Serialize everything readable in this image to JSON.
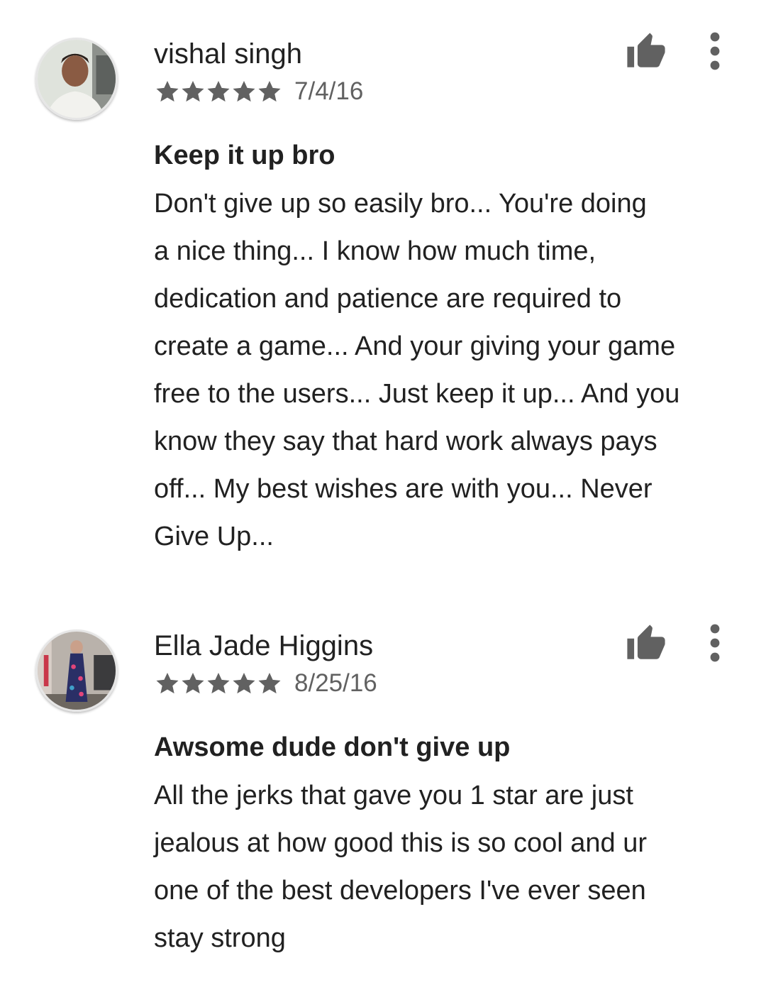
{
  "reviews": [
    {
      "author": "vishal singh",
      "rating": 5,
      "date": "7/4/16",
      "title": "Keep it up bro",
      "body_lines": [
        "Don't give up so easily bro... You're doing",
        "a nice thing... I know how much time,",
        "dedication and patience are required to",
        "create a game... And your giving your game",
        "free to the users... Just keep it up... And you",
        "know they say that hard work always pays",
        "off... My best wishes are with you... Never",
        "Give Up..."
      ]
    },
    {
      "author": "Ella Jade Higgins",
      "rating": 5,
      "date": "8/25/16",
      "title": "Awsome dude don't give up",
      "body_lines": [
        "All the jerks that gave you 1 star are just",
        "jealous at how good this is so cool and ur",
        "one of the best developers I've ever seen",
        "stay strong"
      ]
    }
  ],
  "icons": {
    "thumb": "thumbs-up-icon",
    "more": "more-vert-icon",
    "star": "star-icon"
  },
  "colors": {
    "text": "#212121",
    "secondary_text": "#616161",
    "icon": "#616161",
    "star": "#616161"
  }
}
